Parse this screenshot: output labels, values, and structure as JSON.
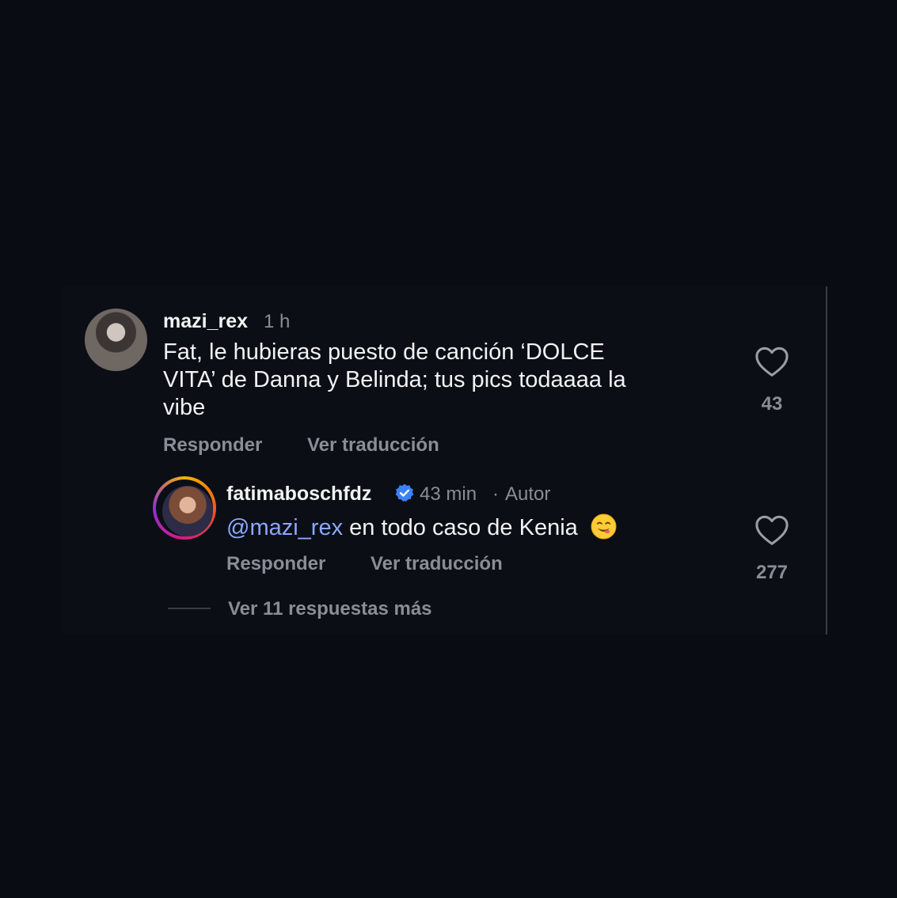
{
  "comment": {
    "username": "mazi_rex",
    "time": "1 h",
    "text_line1": "Fat, le hubieras puesto de canción ‘DOLCE",
    "text_line2": "VITA’ de Danna y Belinda; tus pics todaaaa la",
    "text_line3": "vibe",
    "like_count": "43",
    "reply_label": "Responder",
    "translate_label": "Ver traducción"
  },
  "reply": {
    "username": "fatimaboschfdz",
    "time": "43 min",
    "separator": "·",
    "author_label": "Autor",
    "mention": "@mazi_rex",
    "text": "en todo caso de Kenia",
    "like_count": "277",
    "reply_label": "Responder",
    "translate_label": "Ver traducción"
  },
  "thread": {
    "more_replies_label": "Ver 11 respuestas más"
  },
  "colors": {
    "background": "#0a0c14",
    "muted_text": "#8a8d95",
    "mention": "#8aa8ff",
    "verified": "#3b82f6"
  },
  "icons": {
    "heart": "heart-outline-icon",
    "verified": "verified-badge-icon",
    "emoji": "smiling-face-emoji-icon"
  }
}
